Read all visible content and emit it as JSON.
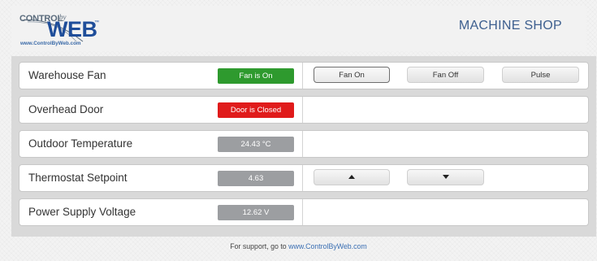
{
  "header": {
    "logo": {
      "line1": "CONTROL",
      "by": "by",
      "line2": "WEB",
      "tm": "™",
      "url": "www.ControlByWeb.com"
    },
    "title": "MACHINE SHOP"
  },
  "colors": {
    "status_on": "#2e9a2e",
    "status_off": "#e01b1b",
    "readout": "#9c9ea1",
    "title": "#3d5f8f",
    "link": "#3b6fb3"
  },
  "rows": [
    {
      "label": "Warehouse Fan",
      "status": "Fan is On",
      "buttons": [
        "Fan On",
        "Fan Off",
        "Pulse"
      ]
    },
    {
      "label": "Overhead Door",
      "status": "Door is Closed"
    },
    {
      "label": "Outdoor Temperature",
      "status": "24.43 °C"
    },
    {
      "label": "Thermostat Setpoint",
      "status": "4.63",
      "buttons_icons": [
        "triangle-up-icon",
        "triangle-down-icon"
      ]
    },
    {
      "label": "Power Supply Voltage",
      "status": "12.62 V"
    }
  ],
  "footer": {
    "text": "For support, go to ",
    "link": "www.ControlByWeb.com"
  }
}
